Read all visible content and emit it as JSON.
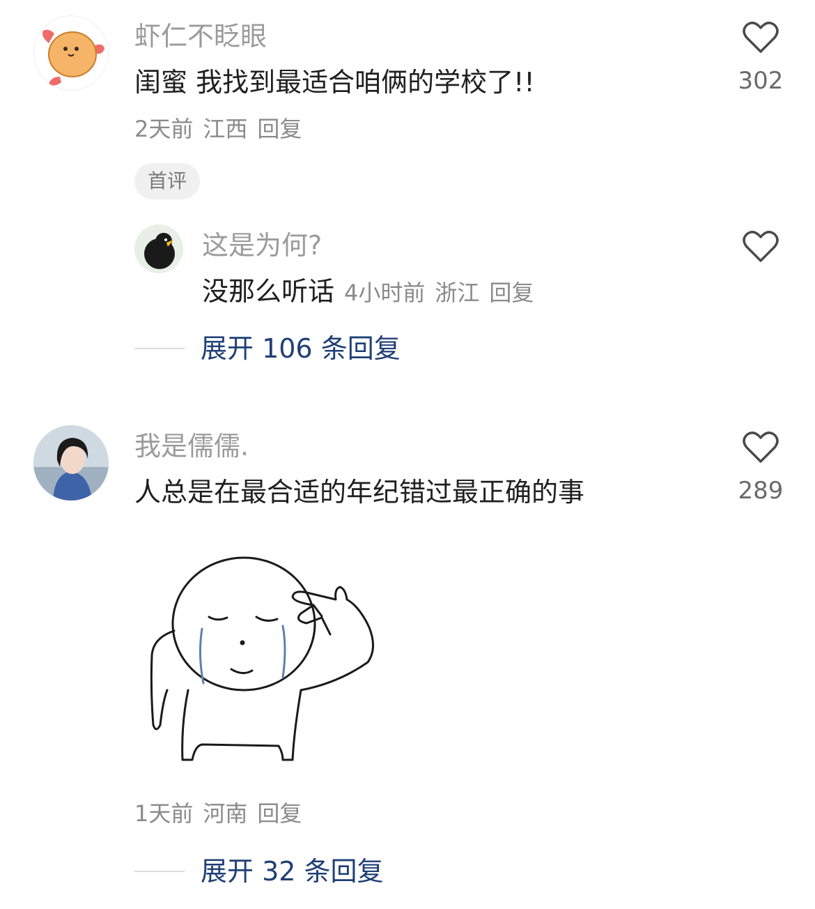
{
  "comments": [
    {
      "username": "虾仁不眨眼",
      "text": "闺蜜 我找到最适合咱俩的学校了!!",
      "time": "2天前",
      "location": "江西",
      "reply_label": "回复",
      "likes": "302",
      "badge": "首评",
      "sub_reply": {
        "username": "这是为何?",
        "text": "没那么听话",
        "time": "4小时前",
        "location": "浙江",
        "reply_label": "回复"
      },
      "expand_label": "展开 106 条回复"
    },
    {
      "username": "我是儒儒.",
      "text": "人总是在最合适的年纪错过最正确的事",
      "time": "1天前",
      "location": "河南",
      "reply_label": "回复",
      "likes": "289",
      "expand_label": "展开 32 条回复"
    }
  ]
}
